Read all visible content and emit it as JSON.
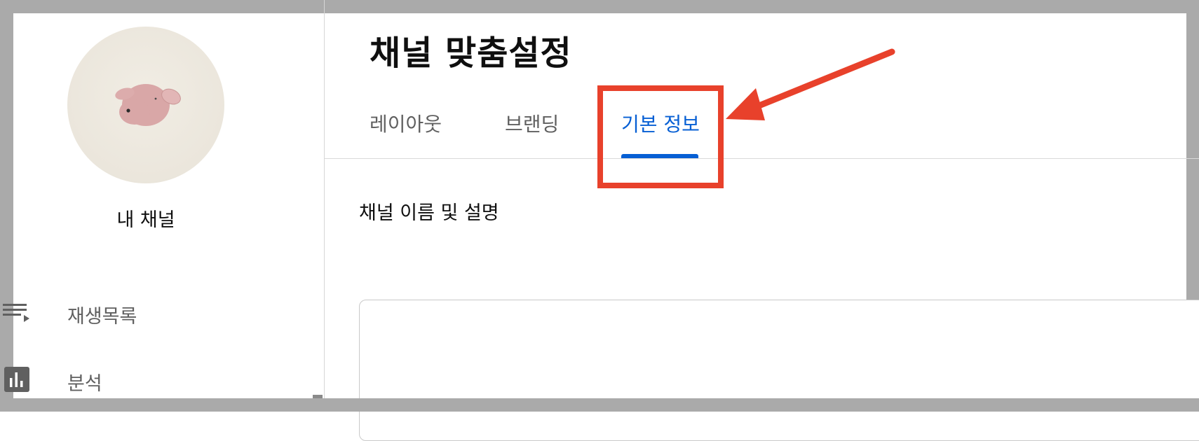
{
  "sidebar": {
    "channel_name": "내 채널",
    "items": [
      {
        "label": "재생목록",
        "icon": "playlist-icon"
      },
      {
        "label": "분석",
        "icon": "analytics-icon"
      }
    ]
  },
  "header": {
    "title": "채널 맞춤설정"
  },
  "tabs": [
    {
      "label": "레이아웃",
      "active": false
    },
    {
      "label": "브랜딩",
      "active": false
    },
    {
      "label": "기본 정보",
      "active": true
    }
  ],
  "basic_info": {
    "section_heading": "채널 이름 및 설명",
    "name_value": ""
  },
  "colors": {
    "accent": "#065fd4",
    "annotation": "#e8412b",
    "frame": "#aaaaaa"
  }
}
